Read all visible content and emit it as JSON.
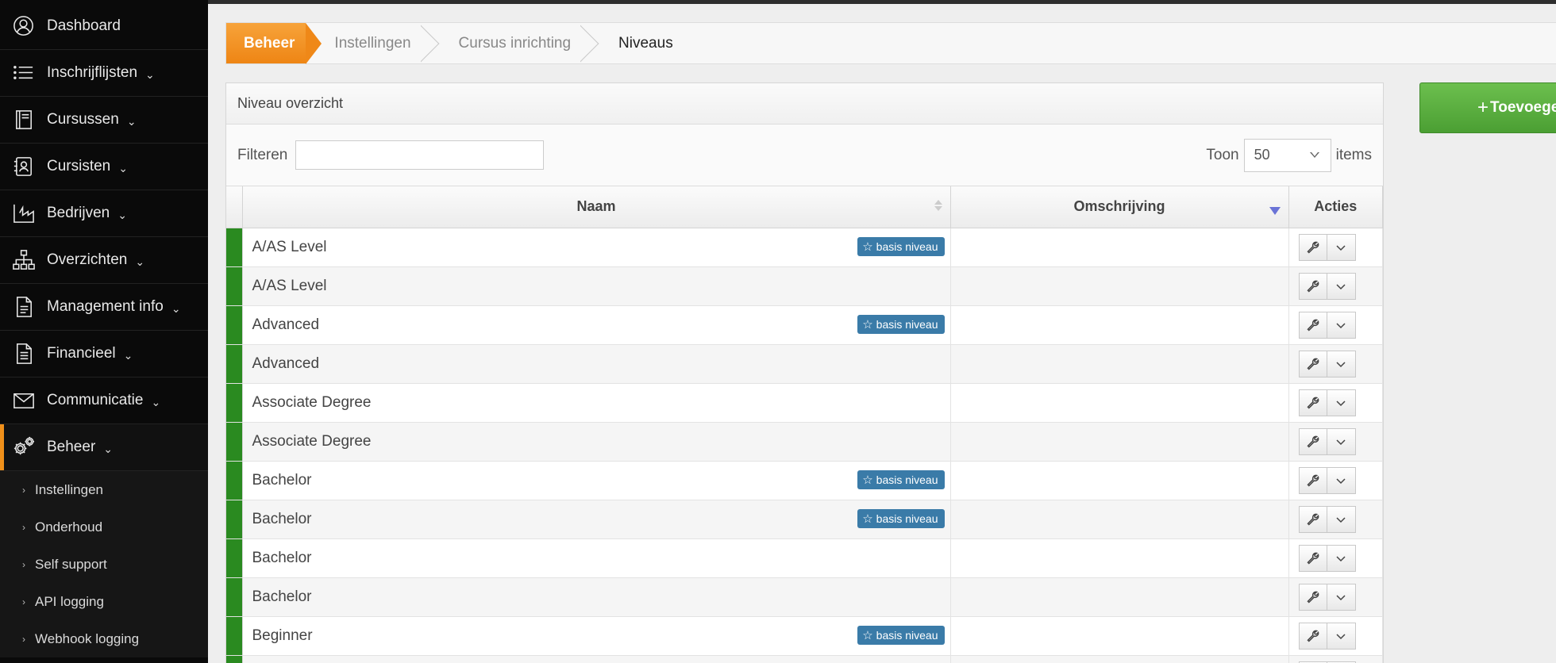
{
  "sidebar": {
    "items": [
      {
        "label": "Dashboard",
        "icon": "user-circle-icon",
        "chevron": false
      },
      {
        "label": "Inschrijflijsten",
        "icon": "list-icon",
        "chevron": true
      },
      {
        "label": "Cursussen",
        "icon": "book-icon",
        "chevron": true
      },
      {
        "label": "Cursisten",
        "icon": "contact-card-icon",
        "chevron": true
      },
      {
        "label": "Bedrijven",
        "icon": "factory-icon",
        "chevron": true
      },
      {
        "label": "Overzichten",
        "icon": "sitemap-icon",
        "chevron": true
      },
      {
        "label": "Management info",
        "icon": "document-icon",
        "chevron": true
      },
      {
        "label": "Financieel",
        "icon": "invoice-icon",
        "chevron": true
      },
      {
        "label": "Communicatie",
        "icon": "envelope-icon",
        "chevron": true
      },
      {
        "label": "Beheer",
        "icon": "gears-icon",
        "chevron": true,
        "active": true
      }
    ],
    "subitems": [
      "Instellingen",
      "Onderhoud",
      "Self support",
      "API logging",
      "Webhook logging"
    ],
    "chevron_glyph": "⌄",
    "sub_arrow_glyph": "›"
  },
  "breadcrumb": [
    "Beheer",
    "Instellingen",
    "Cursus inrichting",
    "Niveaus"
  ],
  "panel": {
    "title": "Niveau overzicht",
    "filter_label": "Filteren",
    "filter_value": "",
    "toon_label": "Toon",
    "toon_value": "50",
    "items_label": "items"
  },
  "table": {
    "columns": {
      "naam": "Naam",
      "omschrijving": "Omschrijving",
      "acties": "Acties"
    },
    "badge_label": "basis niveau",
    "rows": [
      {
        "naam": "A/AS Level",
        "basis": true
      },
      {
        "naam": "A/AS Level",
        "basis": false
      },
      {
        "naam": "Advanced",
        "basis": true
      },
      {
        "naam": "Advanced",
        "basis": false
      },
      {
        "naam": "Associate Degree",
        "basis": false
      },
      {
        "naam": "Associate Degree",
        "basis": false
      },
      {
        "naam": "Bachelor",
        "basis": true
      },
      {
        "naam": "Bachelor",
        "basis": true
      },
      {
        "naam": "Bachelor",
        "basis": false
      },
      {
        "naam": "Bachelor",
        "basis": false
      },
      {
        "naam": "Beginner",
        "basis": true
      },
      {
        "naam": "",
        "basis": false
      }
    ]
  },
  "add_button": {
    "plus": "+",
    "label": "Toevoegen"
  },
  "colors": {
    "accent": "#f0901a",
    "status_green": "#2a8a20",
    "badge_blue": "#3a7ba8",
    "add_green": "#5aae3e"
  }
}
